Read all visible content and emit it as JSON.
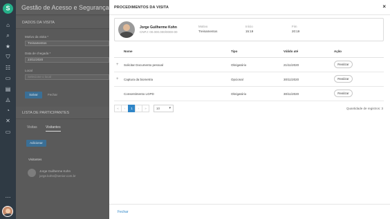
{
  "rail": {
    "logo": "S",
    "icons": [
      "home-icon",
      "search-icon",
      "star-icon",
      "shield-icon",
      "group-icon",
      "briefcase-icon",
      "building-icon",
      "bag-icon",
      "dashboard-icon",
      "tools-icon",
      "monitor-icon",
      "more-icon"
    ]
  },
  "background_app": {
    "title": "Gestão de Acesso e Segurança",
    "section_visit": "DADOS DA VISITA",
    "reason_label": "Motivo da visita *",
    "reason_value": "Treinamentos",
    "date_label": "Data de chegada *",
    "date_value": "23/11/2020",
    "place_label": "Local",
    "place_placeholder": "Selecione o local",
    "save": "Salvar",
    "cancel": "Fechar",
    "section_participants": "LISTA DE PARTICIPANTES",
    "tabs": [
      "Visitas",
      "Visitantes"
    ],
    "add_button": "Adicionar",
    "visitors_title": "Visitantes",
    "visitor_name": "Jorge Guilherme Kohn",
    "visitor_email": "jorge.kohn@senior.com.br"
  },
  "modal": {
    "title": "PROCEDIMENTOS DA VISITA",
    "close_glyph": "×",
    "person": {
      "name": "Jorge Guilherme Kohn",
      "document": "CNPJ: 00.000.000/0000-00"
    },
    "fields": [
      {
        "label": "Motivo",
        "value": "Treinamentos"
      },
      {
        "label": "Início",
        "value": "15:19"
      },
      {
        "label": "Fim",
        "value": "20:19"
      }
    ],
    "table": {
      "headers": [
        "Nome",
        "Tipo",
        "Válido até",
        "Ação"
      ],
      "rows": [
        {
          "expand": "+",
          "name": "Solicitar Documento pessoal",
          "type": "Obrigatório",
          "valid": "21/11/2020",
          "action": "Realizar"
        },
        {
          "expand": "+",
          "name": "Captura da biometria",
          "type": "Opcional",
          "valid": "30/11/2020",
          "action": "Realizar"
        },
        {
          "expand": "",
          "name": "Consentimento LGPD",
          "type": "Obrigatório",
          "valid": "30/11/2020",
          "action": "Realizar"
        }
      ]
    },
    "pagination": {
      "first": "«",
      "prev": "‹",
      "current": "1",
      "next": "›",
      "last": "»",
      "page_size": "10",
      "records_label": "Quantidade de registros: 3"
    },
    "footer_close": "Fechar"
  }
}
